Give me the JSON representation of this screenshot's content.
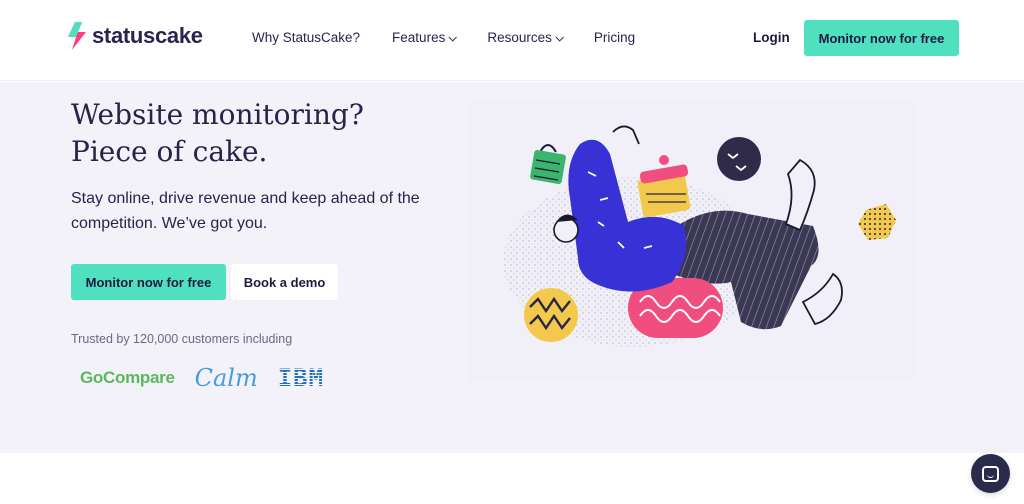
{
  "brand": {
    "name": "statuscake",
    "accent": "#4ee0bf",
    "logo_colors": [
      "#ff3d7f",
      "#4ee0bf"
    ]
  },
  "nav": {
    "links": [
      {
        "label": "Why StatusCake?",
        "dropdown": false
      },
      {
        "label": "Features",
        "dropdown": true
      },
      {
        "label": "Resources",
        "dropdown": true
      },
      {
        "label": "Pricing",
        "dropdown": false
      }
    ],
    "login": "Login",
    "cta": "Monitor now for free"
  },
  "hero": {
    "title": "Website monitoring?\nPiece of cake.",
    "subtitle": "Stay online, drive revenue and keep ahead of the competition. We’ve got you.",
    "primary_cta": "Monitor now for free",
    "secondary_cta": "Book a demo",
    "trusted_text": "Trusted by 120,000 customers including",
    "customer_logos": [
      "GoCompare",
      "Calm",
      "IBM"
    ]
  },
  "chat": {
    "icon": "chat-icon"
  }
}
